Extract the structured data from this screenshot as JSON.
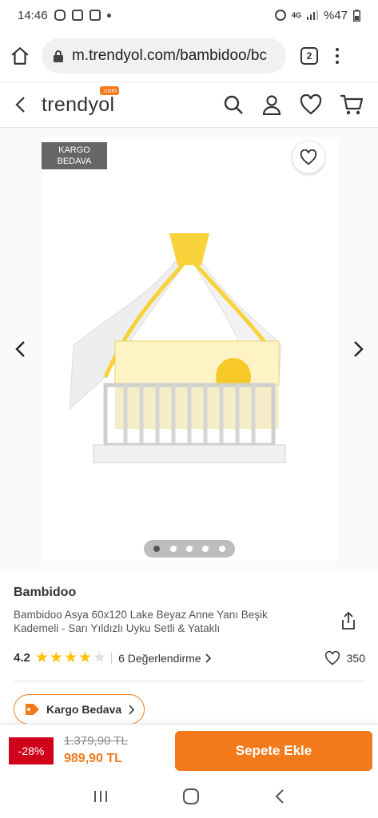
{
  "status_bar": {
    "time": "14:46",
    "network": "4G",
    "battery": "%47"
  },
  "browser": {
    "url": "m.trendyol.com/bambidoo/bc",
    "tab_count": "2"
  },
  "header": {
    "logo": "trendyol",
    "logo_badge": ".com"
  },
  "gallery": {
    "kargo_line1": "KARGO",
    "kargo_line2": "BEDAVA",
    "slide_count": 5,
    "active_slide": 1
  },
  "product": {
    "brand": "Bambidoo",
    "title": "Bambidoo Asya 60x120 Lake Beyaz Anne Yanı Beşik Kademeli - Sarı Yıldızlı Uyku Setli & Yataklı",
    "rating": "4.2",
    "rating_value": 4.2,
    "reviews": "6  Değerlendirme",
    "favorites": "350"
  },
  "shipping_chip": "Kargo Bedava",
  "purchase": {
    "discount": "-28%",
    "old_price": "1.379,90 TL",
    "new_price": "989,90 TL",
    "add_to_cart": "Sepete Ekle"
  },
  "colors": {
    "accent": "#f27a1a",
    "discount": "#d0021b",
    "star": "#ffc000"
  }
}
